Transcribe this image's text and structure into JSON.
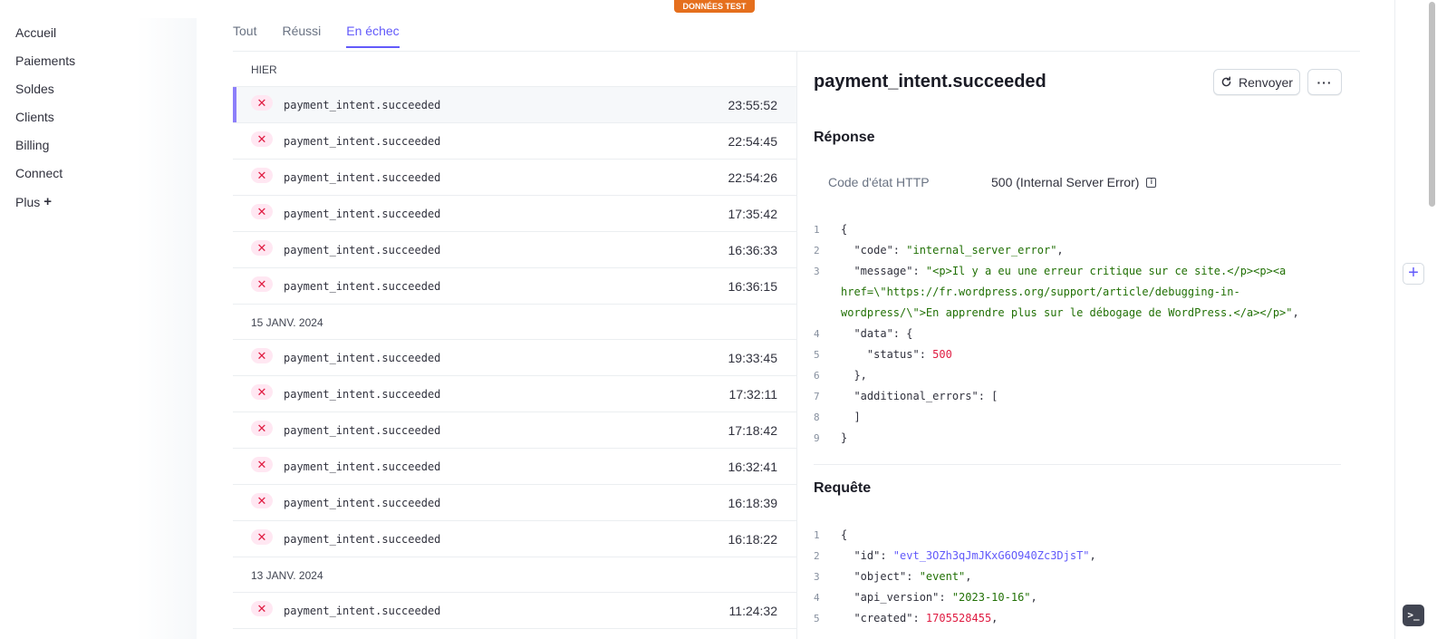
{
  "banner": {
    "label": "DONNÉES TEST"
  },
  "sidebar": {
    "items": [
      {
        "label": "Accueil"
      },
      {
        "label": "Paiements"
      },
      {
        "label": "Soldes"
      },
      {
        "label": "Clients"
      },
      {
        "label": "Billing"
      },
      {
        "label": "Connect"
      },
      {
        "label": "Plus",
        "suffix": "+"
      }
    ]
  },
  "tabs": [
    {
      "label": "Tout"
    },
    {
      "label": "Réussi"
    },
    {
      "label": "En échec",
      "active": true
    }
  ],
  "events": {
    "groups": [
      {
        "label": "HIER",
        "rows": [
          {
            "name": "payment_intent.succeeded",
            "time": "23:55:52",
            "selected": true
          },
          {
            "name": "payment_intent.succeeded",
            "time": "22:54:45"
          },
          {
            "name": "payment_intent.succeeded",
            "time": "22:54:26"
          },
          {
            "name": "payment_intent.succeeded",
            "time": "17:35:42"
          },
          {
            "name": "payment_intent.succeeded",
            "time": "16:36:33"
          },
          {
            "name": "payment_intent.succeeded",
            "time": "16:36:15"
          }
        ]
      },
      {
        "label": "15 JANV. 2024",
        "rows": [
          {
            "name": "payment_intent.succeeded",
            "time": "19:33:45"
          },
          {
            "name": "payment_intent.succeeded",
            "time": "17:32:11"
          },
          {
            "name": "payment_intent.succeeded",
            "time": "17:18:42"
          },
          {
            "name": "payment_intent.succeeded",
            "time": "16:32:41"
          },
          {
            "name": "payment_intent.succeeded",
            "time": "16:18:39"
          },
          {
            "name": "payment_intent.succeeded",
            "time": "16:18:22"
          }
        ]
      },
      {
        "label": "13 JANV. 2024",
        "rows": [
          {
            "name": "payment_intent.succeeded",
            "time": "11:24:32"
          }
        ]
      }
    ],
    "fail_icon": "x-icon"
  },
  "detail": {
    "title": "payment_intent.succeeded",
    "resend_label": "Renvoyer",
    "more_label": "···",
    "response": {
      "title": "Réponse",
      "status_label": "Code d'état HTTP",
      "status_value": "500 (Internal Server Error)",
      "code_lines": [
        [
          {
            "t": "p",
            "v": "{"
          }
        ],
        [
          {
            "t": "p",
            "v": "  \"code\": "
          },
          {
            "t": "str",
            "v": "\"internal_server_error\""
          },
          {
            "t": "p",
            "v": ","
          }
        ],
        [
          {
            "t": "p",
            "v": "  \"message\": "
          },
          {
            "t": "str",
            "v": "\"<p>Il y a eu une erreur critique sur ce site.</p><p><a"
          }
        ],
        [
          {
            "t": "str",
            "v": "href=\\\"https://fr.wordpress.org/support/article/debugging-in-"
          }
        ],
        [
          {
            "t": "str",
            "v": "wordpress/\\\">En apprendre plus sur le débogage de WordPress.</a></p>\""
          },
          {
            "t": "p",
            "v": ","
          }
        ],
        [
          {
            "t": "p",
            "v": "  \"data\": {"
          }
        ],
        [
          {
            "t": "p",
            "v": "    \"status\": "
          },
          {
            "t": "num",
            "v": "500"
          }
        ],
        [
          {
            "t": "p",
            "v": "  },"
          }
        ],
        [
          {
            "t": "p",
            "v": "  \"additional_errors\": ["
          }
        ],
        [
          {
            "t": "p",
            "v": "  ]"
          }
        ],
        [
          {
            "t": "p",
            "v": "}"
          }
        ]
      ],
      "line_numbers": [
        "1",
        "2",
        "3",
        "",
        "",
        "4",
        "5",
        "6",
        "7",
        "8",
        "9"
      ]
    },
    "request": {
      "title": "Requête",
      "code_lines": [
        [
          {
            "t": "p",
            "v": "{"
          }
        ],
        [
          {
            "t": "p",
            "v": "  \"id\": "
          },
          {
            "t": "idstr",
            "v": "\"evt_3OZh3qJmJKxG6O940Zc3DjsT\""
          },
          {
            "t": "p",
            "v": ","
          }
        ],
        [
          {
            "t": "p",
            "v": "  \"object\": "
          },
          {
            "t": "str",
            "v": "\"event\""
          },
          {
            "t": "p",
            "v": ","
          }
        ],
        [
          {
            "t": "p",
            "v": "  \"api_version\": "
          },
          {
            "t": "str",
            "v": "\"2023-10-16\""
          },
          {
            "t": "p",
            "v": ","
          }
        ],
        [
          {
            "t": "p",
            "v": "  \"created\": "
          },
          {
            "t": "num",
            "v": "1705528455"
          },
          {
            "t": "p",
            "v": ","
          }
        ]
      ],
      "line_numbers": [
        "1",
        "2",
        "3",
        "4",
        "5"
      ]
    }
  },
  "right_rail": {
    "add_label": "+",
    "shell_label": ">_"
  }
}
